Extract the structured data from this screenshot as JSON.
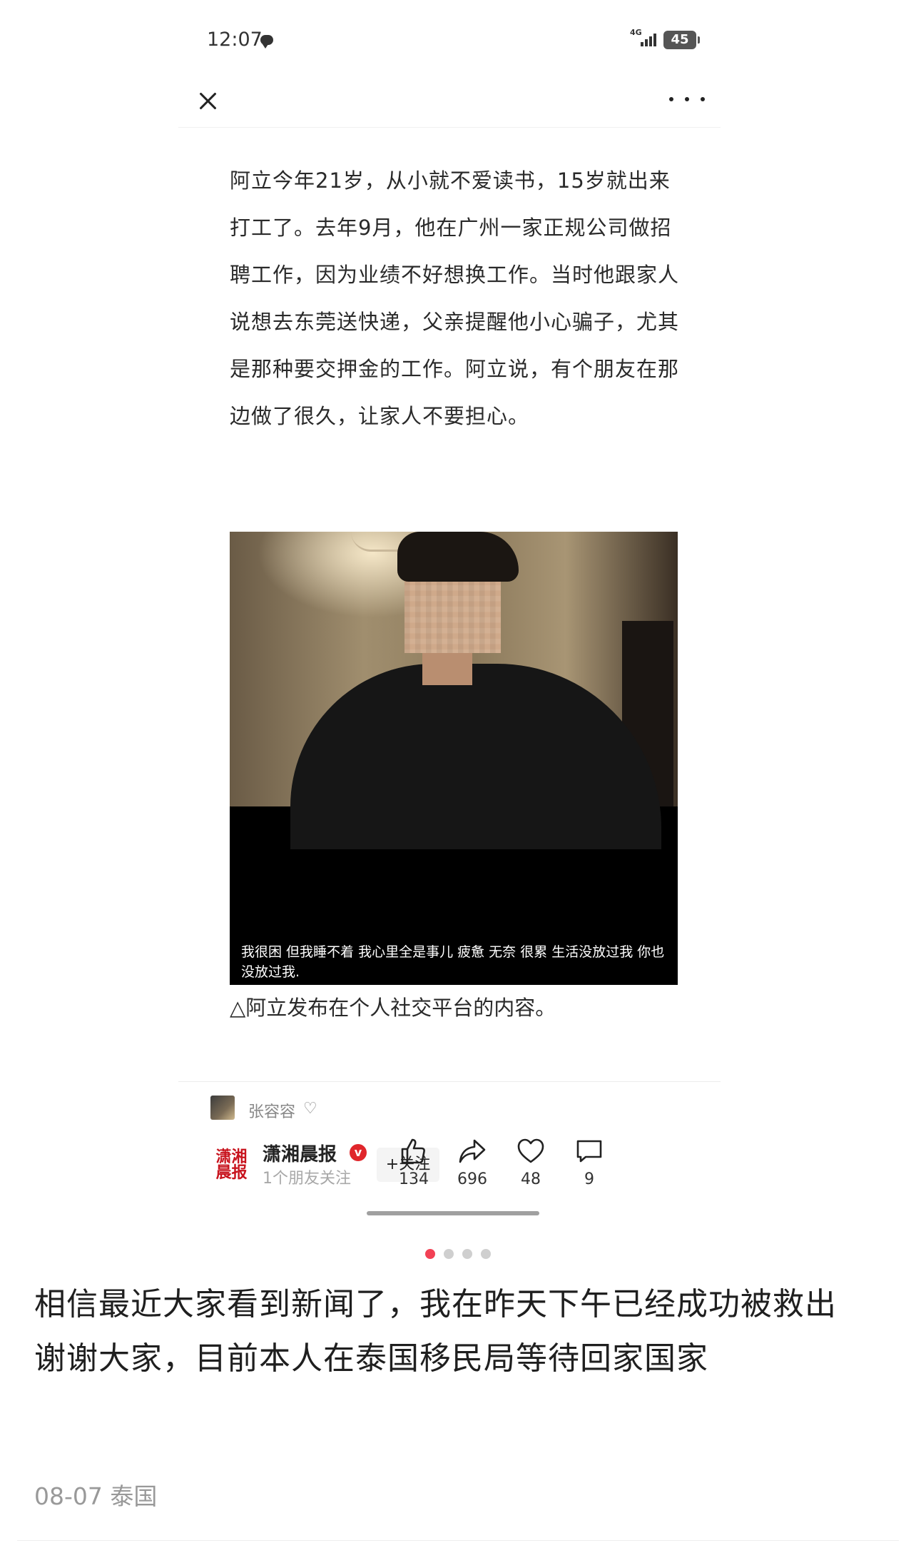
{
  "status_bar": {
    "time": "12:07",
    "network": "4G",
    "battery": "45"
  },
  "article": {
    "paragraph": "阿立今年21岁，从小就不爱读书，15岁就出来打工了。去年9月，他在广州一家正规公司做招聘工作，因为业绩不好想换工作。当时他跟家人说想去东莞送快递，父亲提醒他小心骗子，尤其是那种要交押金的工作。阿立说，有个朋友在那边做了很久，让家人不要担心。",
    "photo_caption": "我很困 但我睡不着 我心里全是事儿 疲惫 无奈 很累 生活没放过我 你也没放过我.",
    "image_note": "△阿立发布在个人社交平台的内容。"
  },
  "author": {
    "name": "张容容"
  },
  "publisher": {
    "logo_text": "潇湘晨报",
    "name": "潇湘晨报",
    "verified_badge": "v",
    "followers": "1个朋友关注",
    "follow_label": "+关注"
  },
  "actions": {
    "like": "134",
    "share": "696",
    "favorite": "48",
    "comment": "9"
  },
  "carousel": {
    "total": 4,
    "active_index": 0
  },
  "post": {
    "body": "相信最近大家看到新闻了，我在昨天下午已经成功被救出\n谢谢大家，目前本人在泰国移民局等待回家国家",
    "date": "08-07",
    "location": "泰国"
  },
  "colors": {
    "accent": "#f24155",
    "verified_red": "#e0262b",
    "logo_red": "#c8141e",
    "meta_gray": "#999999"
  }
}
